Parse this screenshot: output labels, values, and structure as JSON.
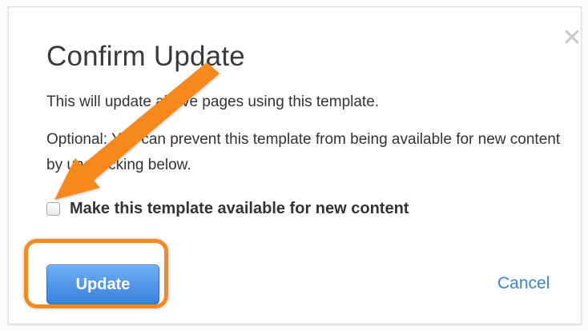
{
  "dialog": {
    "title": "Confirm Update",
    "close_icon": "close-icon",
    "message_line1": "This will update all live pages using this template.",
    "message_line2": "Optional: You can prevent this template from being available for new content by unchecking below.",
    "checkbox_label": "Make this template available for new content",
    "checkbox_checked": false,
    "update_label": "Update",
    "cancel_label": "Cancel"
  },
  "annotations": {
    "arrow_icon": "orange-arrow-icon",
    "highlight_color": "#f7891e"
  },
  "colors": {
    "primary_button": "#3a80dc",
    "link": "#3a84d6",
    "title_text": "#3a3a3a"
  }
}
